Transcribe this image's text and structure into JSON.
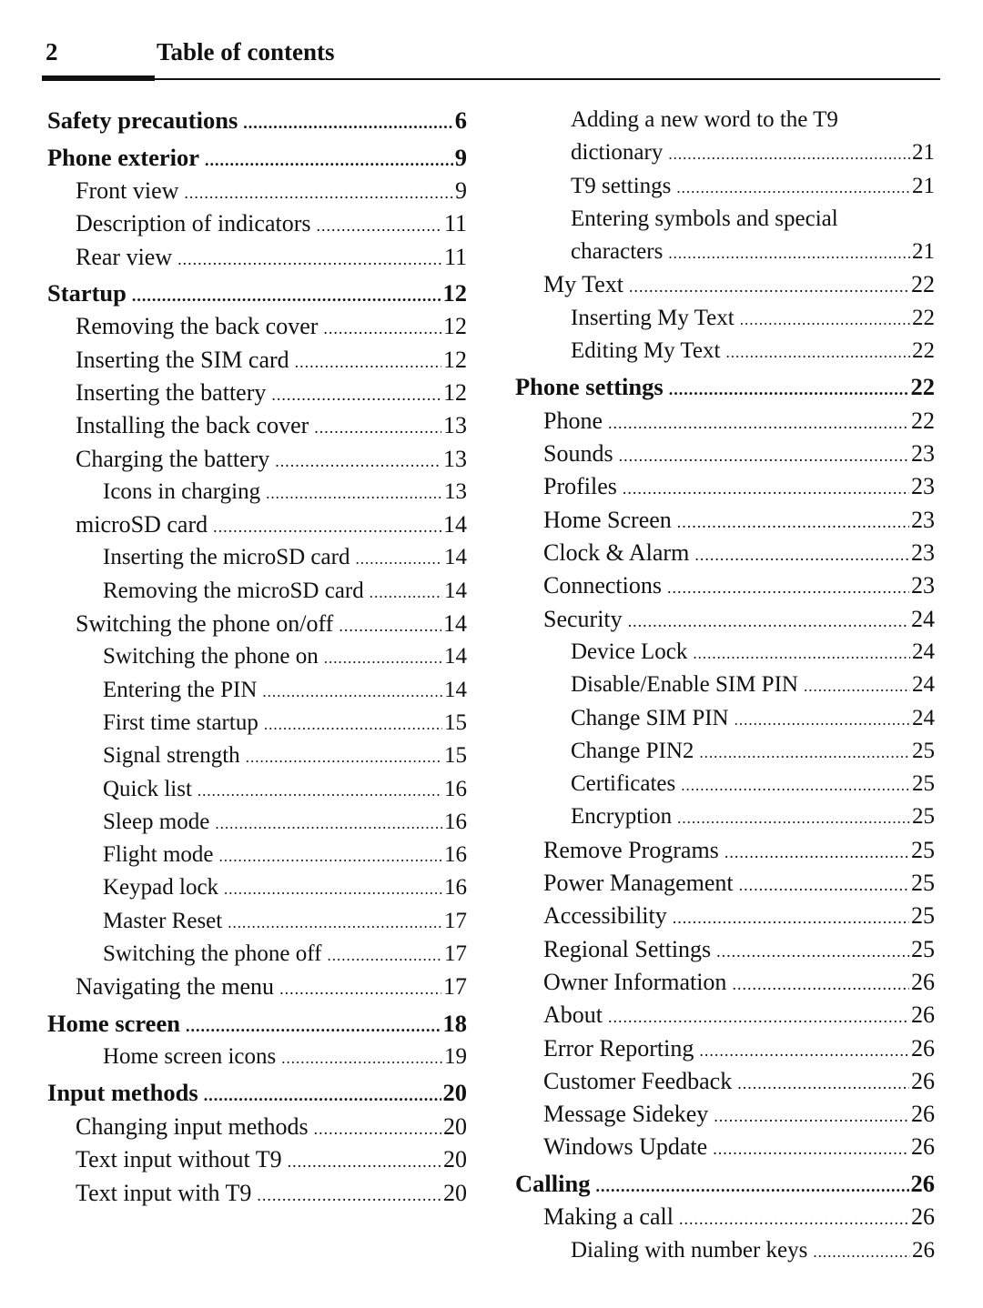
{
  "header": {
    "page_number": "2",
    "title": "Table of contents"
  },
  "left_column": [
    {
      "level": 0,
      "text": "Safety precautions",
      "page": "6"
    },
    {
      "level": 0,
      "text": "Phone exterior",
      "page": "9"
    },
    {
      "level": 1,
      "text": "Front view",
      "page": "9"
    },
    {
      "level": 1,
      "text": "Description of indicators",
      "page": "11"
    },
    {
      "level": 1,
      "text": "Rear view",
      "page": "11"
    },
    {
      "level": 0,
      "text": "Startup",
      "page": "12"
    },
    {
      "level": 1,
      "text": "Removing the back cover",
      "page": "12"
    },
    {
      "level": 1,
      "text": "Inserting the SIM card",
      "page": "12"
    },
    {
      "level": 1,
      "text": "Inserting the battery",
      "page": "12"
    },
    {
      "level": 1,
      "text": "Installing the back cover",
      "page": "13"
    },
    {
      "level": 1,
      "text": "Charging the battery",
      "page": "13"
    },
    {
      "level": 2,
      "text": "Icons in charging",
      "page": "13"
    },
    {
      "level": 1,
      "text": "microSD card",
      "page": "14"
    },
    {
      "level": 2,
      "text": "Inserting the microSD card",
      "page": "14"
    },
    {
      "level": 2,
      "text": "Removing the microSD card",
      "page": "14"
    },
    {
      "level": 1,
      "text": "Switching the phone on/off",
      "page": "14"
    },
    {
      "level": 2,
      "text": "Switching the phone on",
      "page": "14"
    },
    {
      "level": 2,
      "text": "Entering the PIN",
      "page": "14"
    },
    {
      "level": 2,
      "text": "First time startup",
      "page": "15"
    },
    {
      "level": 2,
      "text": "Signal strength",
      "page": "15"
    },
    {
      "level": 2,
      "text": "Quick list",
      "page": "16"
    },
    {
      "level": 2,
      "text": "Sleep mode",
      "page": "16"
    },
    {
      "level": 2,
      "text": "Flight mode",
      "page": "16"
    },
    {
      "level": 2,
      "text": "Keypad lock",
      "page": "16"
    },
    {
      "level": 2,
      "text": "Master Reset",
      "page": "17"
    },
    {
      "level": 2,
      "text": "Switching the phone off",
      "page": "17"
    },
    {
      "level": 1,
      "text": "Navigating the menu",
      "page": "17"
    },
    {
      "level": 0,
      "text": "Home screen",
      "page": "18"
    },
    {
      "level": 2,
      "text": "Home screen icons",
      "page": "19"
    },
    {
      "level": 0,
      "text": "Input methods",
      "page": "20"
    },
    {
      "level": 1,
      "text": "Changing input methods",
      "page": "20"
    },
    {
      "level": 1,
      "text": "Text input without T9",
      "page": "20"
    },
    {
      "level": 1,
      "text": "Text input with T9",
      "page": "20"
    }
  ],
  "right_column": [
    {
      "level": 2,
      "text": "Adding a new word to the T9",
      "continuation": "dictionary",
      "page": "21"
    },
    {
      "level": 2,
      "text": "T9 settings",
      "page": "21"
    },
    {
      "level": 2,
      "text": "Entering symbols and special",
      "continuation": "characters",
      "page": "21"
    },
    {
      "level": 1,
      "text": "My Text",
      "page": "22"
    },
    {
      "level": 2,
      "text": "Inserting My Text",
      "page": "22"
    },
    {
      "level": 2,
      "text": "Editing My Text",
      "page": "22"
    },
    {
      "level": 0,
      "text": "Phone settings",
      "page": "22"
    },
    {
      "level": 1,
      "text": "Phone",
      "page": "22"
    },
    {
      "level": 1,
      "text": "Sounds",
      "page": "23"
    },
    {
      "level": 1,
      "text": "Profiles",
      "page": "23"
    },
    {
      "level": 1,
      "text": "Home Screen",
      "page": "23"
    },
    {
      "level": 1,
      "text": "Clock & Alarm",
      "page": "23"
    },
    {
      "level": 1,
      "text": "Connections",
      "page": "23"
    },
    {
      "level": 1,
      "text": "Security",
      "page": "24"
    },
    {
      "level": 2,
      "text": "Device Lock",
      "page": "24"
    },
    {
      "level": 2,
      "text": "Disable/Enable SIM PIN",
      "page": "24"
    },
    {
      "level": 2,
      "text": "Change SIM PIN",
      "page": "24"
    },
    {
      "level": 2,
      "text": "Change PIN2",
      "page": "25"
    },
    {
      "level": 2,
      "text": "Certificates",
      "page": "25"
    },
    {
      "level": 2,
      "text": "Encryption",
      "page": "25"
    },
    {
      "level": 1,
      "text": "Remove Programs",
      "page": "25"
    },
    {
      "level": 1,
      "text": "Power Management",
      "page": "25"
    },
    {
      "level": 1,
      "text": "Accessibility",
      "page": "25"
    },
    {
      "level": 1,
      "text": "Regional Settings",
      "page": "25"
    },
    {
      "level": 1,
      "text": "Owner Information",
      "page": "26"
    },
    {
      "level": 1,
      "text": "About",
      "page": "26"
    },
    {
      "level": 1,
      "text": "Error Reporting",
      "page": "26"
    },
    {
      "level": 1,
      "text": "Customer Feedback",
      "page": "26"
    },
    {
      "level": 1,
      "text": "Message Sidekey",
      "page": "26"
    },
    {
      "level": 1,
      "text": "Windows Update",
      "page": "26"
    },
    {
      "level": 0,
      "text": "Calling",
      "page": "26"
    },
    {
      "level": 1,
      "text": "Making a call",
      "page": "26"
    },
    {
      "level": 2,
      "text": "Dialing with number keys",
      "page": "26"
    }
  ]
}
